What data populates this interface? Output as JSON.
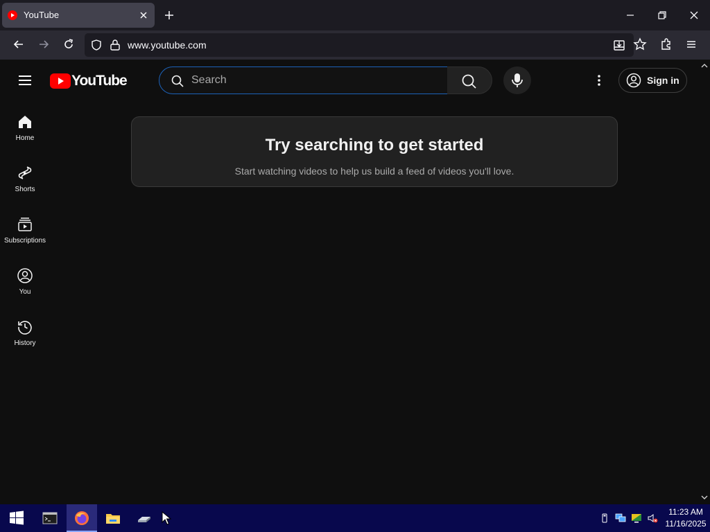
{
  "browser": {
    "tab": {
      "title": "YouTube"
    },
    "url": "www.youtube.com"
  },
  "youtube": {
    "logo_text": "YouTube",
    "search": {
      "placeholder": "Search",
      "value": ""
    },
    "sign_in_label": "Sign in",
    "sidebar": {
      "items": [
        {
          "label": "Home",
          "icon": "home-icon"
        },
        {
          "label": "Shorts",
          "icon": "shorts-icon"
        },
        {
          "label": "Subscriptions",
          "icon": "subscriptions-icon"
        },
        {
          "label": "You",
          "icon": "you-icon"
        },
        {
          "label": "History",
          "icon": "history-icon"
        }
      ]
    },
    "empty_state": {
      "title": "Try searching to get started",
      "subtitle": "Start watching videos to help us build a feed of videos you'll love."
    },
    "colors": {
      "brand_red": "#ff0000",
      "search_focus": "#1c62b9",
      "background": "#0f0f0f"
    }
  },
  "taskbar": {
    "apps": [
      "start-icon",
      "terminal-icon",
      "firefox-icon",
      "file-explorer-icon",
      "drive-icon"
    ],
    "clock": {
      "time": "11:23 AM",
      "date": "11/16/2025"
    }
  }
}
